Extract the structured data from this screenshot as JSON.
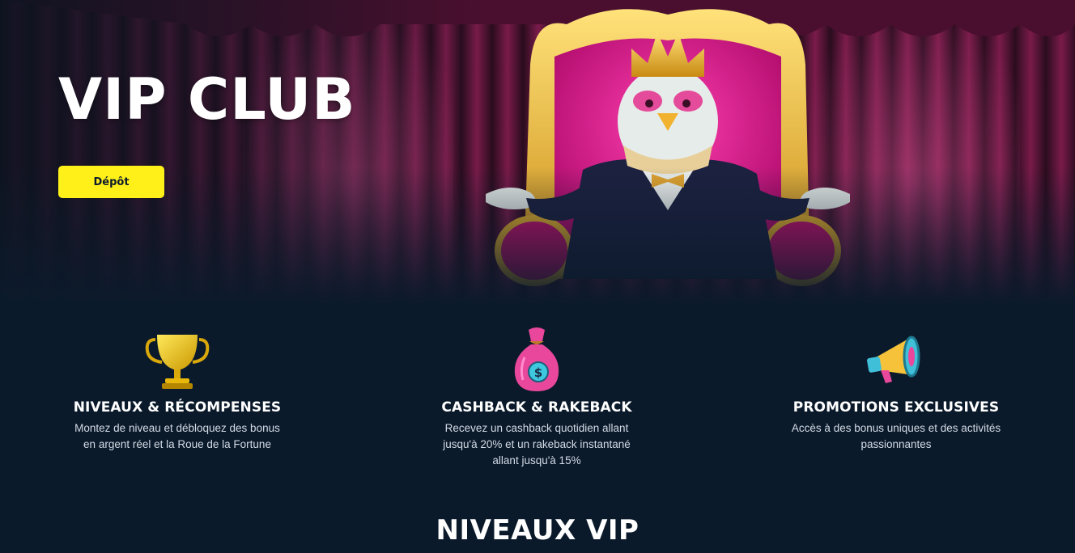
{
  "hero": {
    "title": "VIP CLUB",
    "deposit_label": "Dépôt",
    "mascot": "chicken-king-on-throne-illustration"
  },
  "features": [
    {
      "icon": "trophy-icon",
      "title": "NIVEAUX & RÉCOMPENSES",
      "line1": "Montez de niveau et débloquez des bonus",
      "line2": "en argent réel et la Roue de la Fortune",
      "line3": ""
    },
    {
      "icon": "money-bag-icon",
      "title": "CASHBACK & RAKEBACK",
      "line1": "Recevez un cashback quotidien allant",
      "line2": "jusqu'à 20% et un rakeback instantané",
      "line3": "allant jusqu'à 15%"
    },
    {
      "icon": "megaphone-icon",
      "title": "PROMOTIONS EXCLUSIVES",
      "line1": "Accès à des bonus uniques et des activités",
      "line2": "passionnantes",
      "line3": ""
    }
  ],
  "levels": {
    "title": "NIVEAUX VIP"
  },
  "colors": {
    "background": "#0b1a2b",
    "accent": "#fff01a",
    "curtain": "#6b1640",
    "throne": "#e8189a"
  }
}
